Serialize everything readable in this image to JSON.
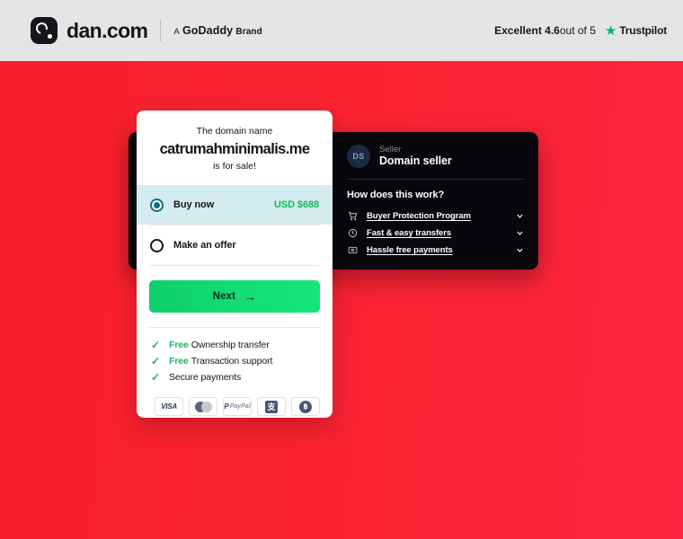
{
  "header": {
    "logo_text": "dan.com",
    "logo_icon": "dan-logo-icon",
    "brand_a": "A",
    "brand_godaddy": "GoDaddy",
    "brand_word": "Brand",
    "trustpilot": {
      "rating_text": "Excellent 4.6",
      "out_of": " out of 5",
      "star": "★",
      "name": "Trustpilot"
    }
  },
  "card": {
    "pre_text": "The domain name",
    "domain_name": "catrumahminimalis.me",
    "post_text": "is for sale!",
    "options": [
      {
        "label": "Buy now",
        "price": "USD $688",
        "selected": true
      },
      {
        "label": "Make an offer",
        "price": "",
        "selected": false
      }
    ],
    "next_label": "Next",
    "next_arrow": "→",
    "benefits": [
      {
        "check": "✓",
        "free": "Free",
        "text": "Ownership transfer"
      },
      {
        "check": "✓",
        "free": "Free",
        "text": "Transaction support"
      },
      {
        "check": "✓",
        "free": "",
        "text": "Secure payments"
      }
    ],
    "payments": [
      {
        "name": "visa",
        "label": "VISA"
      },
      {
        "name": "mastercard",
        "label": ""
      },
      {
        "name": "paypal",
        "label": "PayPal"
      },
      {
        "name": "alipay",
        "label": "支"
      },
      {
        "name": "bitcoin",
        "label": "฿"
      }
    ]
  },
  "seller_panel": {
    "avatar_initials": "DS",
    "seller_label": "Seller",
    "seller_name": "Domain seller",
    "how_title": "How does this work?",
    "accordion": [
      {
        "icon": "cart-icon",
        "label": "Buyer Protection Program",
        "chevron": "⌄"
      },
      {
        "icon": "clock-icon",
        "label": "Fast & easy transfers",
        "chevron": "⌄"
      },
      {
        "icon": "payment-card-icon",
        "label": "Hassle free payments",
        "chevron": "⌄"
      }
    ]
  },
  "colors": {
    "background_red": "#f7202f",
    "header_gray": "#e4e5e7",
    "panel_black": "#07070c",
    "accent_green": "#12ba5e",
    "selected_teal": "#0f6f80",
    "selected_row_bg": "#d4ecf0",
    "trustpilot_green": "#00b67a"
  }
}
